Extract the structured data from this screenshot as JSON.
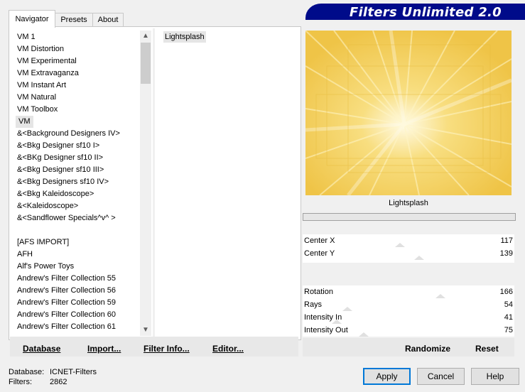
{
  "banner": {
    "title": "Filters Unlimited 2.0"
  },
  "tabs": [
    {
      "label": "Navigator"
    },
    {
      "label": "Presets"
    },
    {
      "label": "About"
    }
  ],
  "categories": [
    "VM 1",
    "VM Distortion",
    "VM Experimental",
    "VM Extravaganza",
    "VM Instant Art",
    "VM Natural",
    "VM Toolbox",
    "VM",
    "&<Background Designers IV>",
    "&<Bkg Designer sf10 I>",
    "&<BKg Designer sf10 II>",
    "&<Bkg Designer sf10 III>",
    "&<Bkg Designers sf10 IV>",
    "&<Bkg Kaleidoscope>",
    "&<Kaleidoscope>",
    "&<Sandflower Specials^v^ >",
    "",
    "[AFS IMPORT]",
    "AFH",
    "Alf's Power Toys",
    "Andrew's Filter Collection 55",
    "Andrew's Filter Collection 56",
    "Andrew's Filter Collection 59",
    "Andrew's Filter Collection 60",
    "Andrew's Filter Collection 61"
  ],
  "selected_category": "VM",
  "filters": [
    "Lightsplash"
  ],
  "left_buttons": {
    "database": "Database",
    "import": "Import...",
    "filter_info": "Filter Info...",
    "editor": "Editor..."
  },
  "preview": {
    "filter_name": "Lightsplash",
    "colors": {
      "base": "#f2cc55",
      "ray": "#fff6c8"
    }
  },
  "parameters": [
    {
      "label": "Center X",
      "value": "117",
      "level": 0.46
    },
    {
      "label": "Center Y",
      "value": "139",
      "level": 0.55
    },
    {
      "label": "",
      "value": ""
    },
    {
      "label": "",
      "value": ""
    },
    {
      "label": "Rotation",
      "value": "166",
      "level": 0.65
    },
    {
      "label": "Rays",
      "value": "54",
      "level": 0.21
    },
    {
      "label": "Intensity In",
      "value": "41",
      "level": 0.16
    },
    {
      "label": "Intensity Out",
      "value": "75",
      "level": 0.29
    }
  ],
  "right_buttons": {
    "randomize": "Randomize",
    "reset": "Reset"
  },
  "status": {
    "database_label": "Database:",
    "database_value": "ICNET-Filters",
    "filters_label": "Filters:",
    "filters_value": "2862"
  },
  "dialog_buttons": {
    "apply": "Apply",
    "cancel": "Cancel",
    "help": "Help"
  }
}
